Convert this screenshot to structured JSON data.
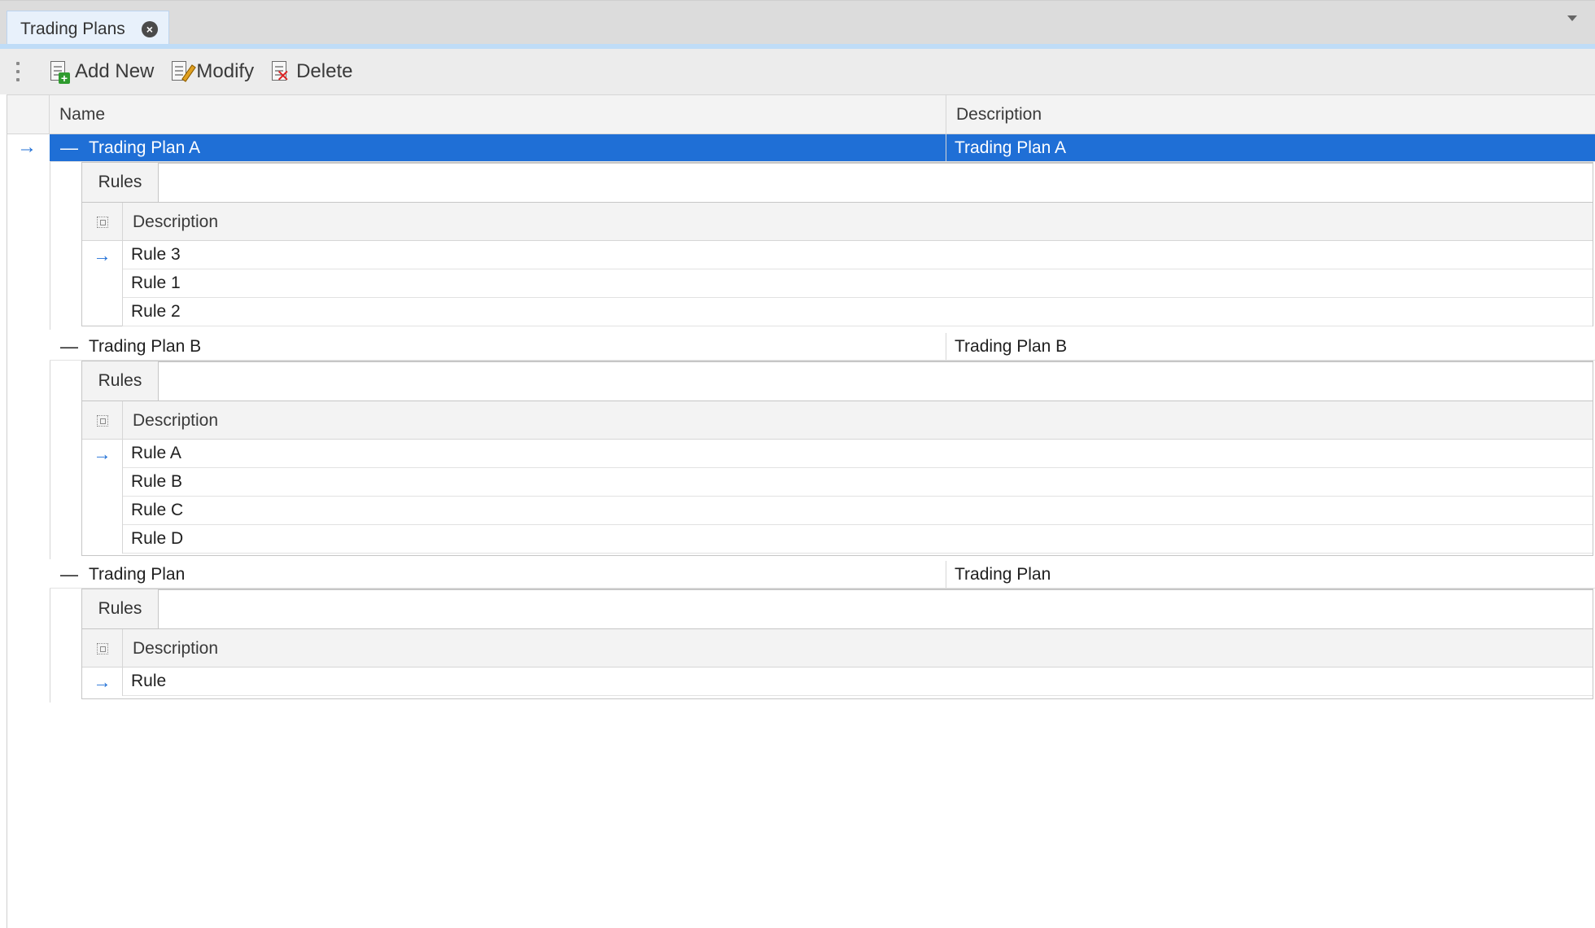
{
  "document_tab": {
    "title": "Trading Plans"
  },
  "toolbar": {
    "add_label": "Add New",
    "modify_label": "Modify",
    "delete_label": "Delete"
  },
  "grid": {
    "columns": {
      "name": "Name",
      "description": "Description"
    },
    "plans": [
      {
        "name": "Trading Plan A",
        "description": "Trading Plan A",
        "detail_tab": "Rules",
        "detail_column": "Description",
        "rules": [
          "Rule 3",
          "Rule 1",
          "Rule 2"
        ]
      },
      {
        "name": "Trading Plan B",
        "description": "Trading Plan B",
        "detail_tab": "Rules",
        "detail_column": "Description",
        "rules": [
          "Rule A",
          "Rule B",
          "Rule C",
          "Rule D"
        ]
      },
      {
        "name": "Trading Plan",
        "description": "Trading Plan",
        "detail_tab": "Rules",
        "detail_column": "Description",
        "rules": [
          "Rule"
        ]
      }
    ]
  },
  "colors": {
    "selection": "#1f6fd6",
    "tab_accent": "#bfdcf7"
  }
}
